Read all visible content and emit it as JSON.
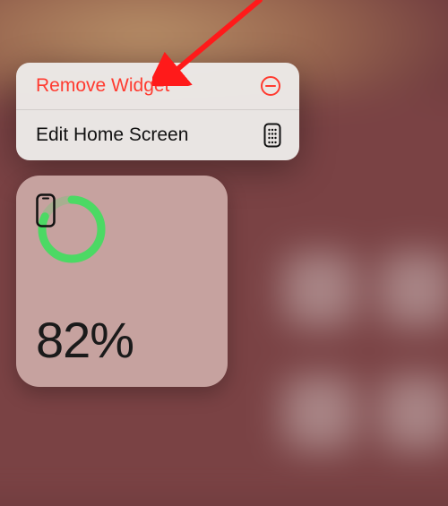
{
  "menu": {
    "remove_label": "Remove Widget",
    "edit_label": "Edit Home Screen"
  },
  "widget": {
    "battery_percent_text": "82%",
    "battery_percent_value": 82
  },
  "annotation": {
    "arrow_target": "remove-widget-menu-item",
    "arrow_color": "#ff1a1a"
  },
  "colors": {
    "destructive": "#ff3b30",
    "ring_green": "#4cd964"
  }
}
